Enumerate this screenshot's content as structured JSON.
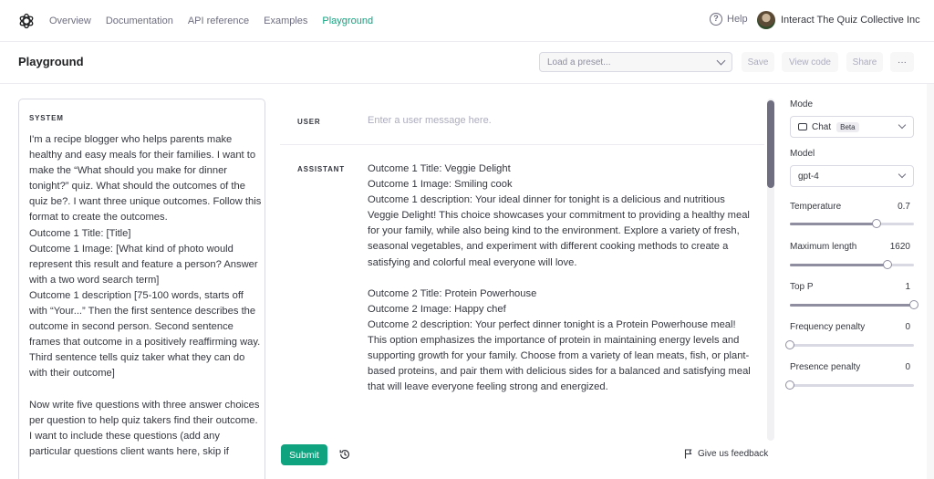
{
  "nav": {
    "links": [
      "Overview",
      "Documentation",
      "API reference",
      "Examples",
      "Playground"
    ],
    "active": "Playground",
    "help_label": "Help",
    "org_name": "Interact The Quiz Collective Inc"
  },
  "header": {
    "title": "Playground",
    "preset_placeholder": "Load a preset...",
    "save_label": "Save",
    "view_code_label": "View code",
    "share_label": "Share",
    "more_label": "···"
  },
  "system": {
    "label": "SYSTEM",
    "text": "I'm a recipe blogger who helps parents make healthy and easy meals for their families. I want to make the “What should you make for dinner tonight?” quiz. What should the outcomes of the quiz be?. I want three unique outcomes. Follow this format to create the outcomes.\nOutcome 1 Title: [Title]\nOutcome 1 Image: [What kind of photo would represent this result and feature a person? Answer with a two word search term]\nOutcome 1 description [75-100 words, starts off with “Your...” Then the first sentence describes the outcome in second person. Second sentence frames that outcome in a positively reaffirming way. Third sentence tells quiz taker what they can do with their outcome]\n\nNow write five questions with three answer choices per question to help quiz takers find their outcome.\nI want to include these questions (add any particular questions client wants here, skip if"
  },
  "messages": {
    "user_role": "USER",
    "user_placeholder": "Enter a user message here.",
    "assistant_role": "ASSISTANT",
    "assistant_text": "Outcome 1 Title: Veggie Delight\nOutcome 1 Image: Smiling cook\nOutcome 1 description: Your ideal dinner for tonight is a delicious and nutritious Veggie Delight! This choice showcases your commitment to providing a healthy meal for your family, while also being kind to the environment. Explore a variety of fresh, seasonal vegetables, and experiment with different cooking methods to create a satisfying and colorful meal everyone will love.\n\nOutcome 2 Title: Protein Powerhouse\nOutcome 2 Image: Happy chef\nOutcome 2 description: Your perfect dinner tonight is a Protein Powerhouse meal! This option emphasizes the importance of protein in maintaining energy levels and supporting growth for your family. Choose from a variety of lean meats, fish, or plant-based proteins, and pair them with delicious sides for a balanced and satisfying meal that will leave everyone feeling strong and energized."
  },
  "footer": {
    "submit_label": "Submit",
    "feedback_label": "Give us feedback"
  },
  "settings": {
    "mode_label": "Mode",
    "mode_value": "Chat",
    "mode_badge": "Beta",
    "model_label": "Model",
    "model_value": "gpt-4",
    "sliders": [
      {
        "label": "Temperature",
        "value": "0.7",
        "fraction": 0.7
      },
      {
        "label": "Maximum length",
        "value": "1620",
        "fraction": 0.79
      },
      {
        "label": "Top P",
        "value": "1",
        "fraction": 1.0
      },
      {
        "label": "Frequency penalty",
        "value": "0",
        "fraction": 0.0
      },
      {
        "label": "Presence penalty",
        "value": "0",
        "fraction": 0.0
      }
    ]
  },
  "colors": {
    "accent": "#10a37f",
    "text": "#353740",
    "muted": "#6e6e80",
    "border": "#d9d9e3"
  }
}
